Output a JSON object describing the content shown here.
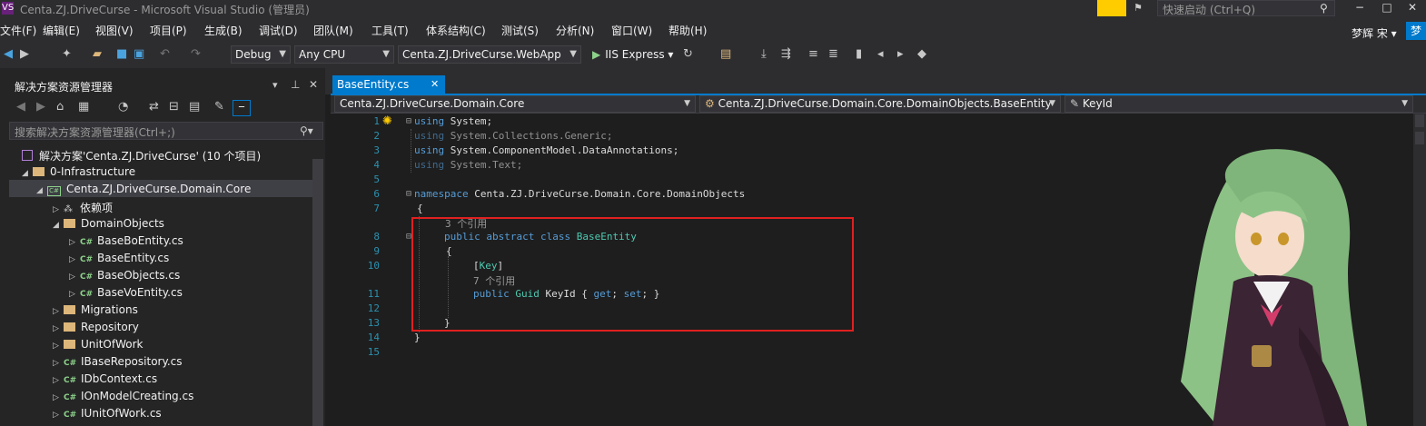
{
  "titlebar": {
    "logo": "VS",
    "title": "Centa.ZJ.DriveCurse - Microsoft Visual Studio (管理员)",
    "quick_launch_placeholder": "快速启动 (Ctrl+Q)",
    "minimize": "−",
    "maximize": "□",
    "close": "✕",
    "notification_icon": "notification-flag-icon"
  },
  "menu": {
    "items": [
      "文件(F)",
      "编辑(E)",
      "视图(V)",
      "项目(P)",
      "生成(B)",
      "调试(D)",
      "团队(M)",
      "工具(T)",
      "体系结构(C)",
      "测试(S)",
      "分析(N)",
      "窗口(W)",
      "帮助(H)"
    ],
    "user_name": "梦辉 宋 ▾",
    "user_avatar": "梦"
  },
  "toolbar": {
    "config": "Debug",
    "platform": "Any CPU",
    "startup_project": "Centa.ZJ.DriveCurse.WebApp",
    "run_label": "IIS Express"
  },
  "solution_explorer": {
    "title": "解决方案资源管理器",
    "search_placeholder": "搜索解决方案资源管理器(Ctrl+;)",
    "tree": [
      {
        "label": "解决方案'Centa.ZJ.DriveCurse' (10 个项目)",
        "icon": "solution"
      },
      {
        "label": "0-Infrastructure",
        "icon": "folder"
      },
      {
        "label": "Centa.ZJ.DriveCurse.Domain.Core",
        "icon": "project"
      },
      {
        "label": "依赖项",
        "icon": "dependencies"
      },
      {
        "label": "DomainObjects",
        "icon": "folder"
      },
      {
        "label": "BaseBoEntity.cs",
        "icon": "cs"
      },
      {
        "label": "BaseEntity.cs",
        "icon": "cs"
      },
      {
        "label": "BaseObjects.cs",
        "icon": "cs"
      },
      {
        "label": "BaseVoEntity.cs",
        "icon": "cs"
      },
      {
        "label": "Migrations",
        "icon": "folder"
      },
      {
        "label": "Repository",
        "icon": "folder"
      },
      {
        "label": "UnitOfWork",
        "icon": "folder"
      },
      {
        "label": "IBaseRepository.cs",
        "icon": "cs"
      },
      {
        "label": "IDbContext.cs",
        "icon": "cs"
      },
      {
        "label": "IOnModelCreating.cs",
        "icon": "cs"
      },
      {
        "label": "IUnitOfWork.cs",
        "icon": "cs"
      }
    ]
  },
  "editor": {
    "tab": "BaseEntity.cs",
    "tab_close": "✕",
    "nav_project": "Centa.ZJ.DriveCurse.Domain.Core",
    "nav_type": "Centa.ZJ.DriveCurse.Domain.Core.DomainObjects.BaseEntity",
    "nav_member": "KeyId",
    "line_numbers": [
      "1",
      "2",
      "3",
      "4",
      "5",
      "6",
      "7",
      "8",
      "9",
      "10",
      "11",
      "12",
      "13",
      "14",
      "15"
    ],
    "lines": {
      "l1_kw": "using",
      "l1_rest": " System;",
      "l2_kw": "using",
      "l2_rest": " System.Collections.Generic;",
      "l3_kw": "using",
      "l3_rest": " System.ComponentModel.DataAnnotations;",
      "l4_kw": "using",
      "l4_rest": " System.Text;",
      "l6_kw": "namespace",
      "l6_rest": " Centa.ZJ.DriveCurse.Domain.Core.DomainObjects",
      "l7": "{",
      "lens1": "3 个引用",
      "l8_kw": "public abstract class",
      "l8_ty": "BaseEntity",
      "l9": "{",
      "l10_open": "[",
      "l10_ty": "Key",
      "l10_close": "]",
      "lens2": "7 个引用",
      "l11_kw": "public",
      "l11_ty": "Guid",
      "l11_name": "KeyId { ",
      "l11_get": "get",
      "l11_semi1": "; ",
      "l11_set": "set",
      "l11_end": "; }",
      "l13": "}",
      "l14": "}"
    }
  },
  "colors": {
    "accent": "#007acc",
    "keyword": "#569cd6",
    "type": "#4ec9b0",
    "highlight_box": "#e02020"
  }
}
